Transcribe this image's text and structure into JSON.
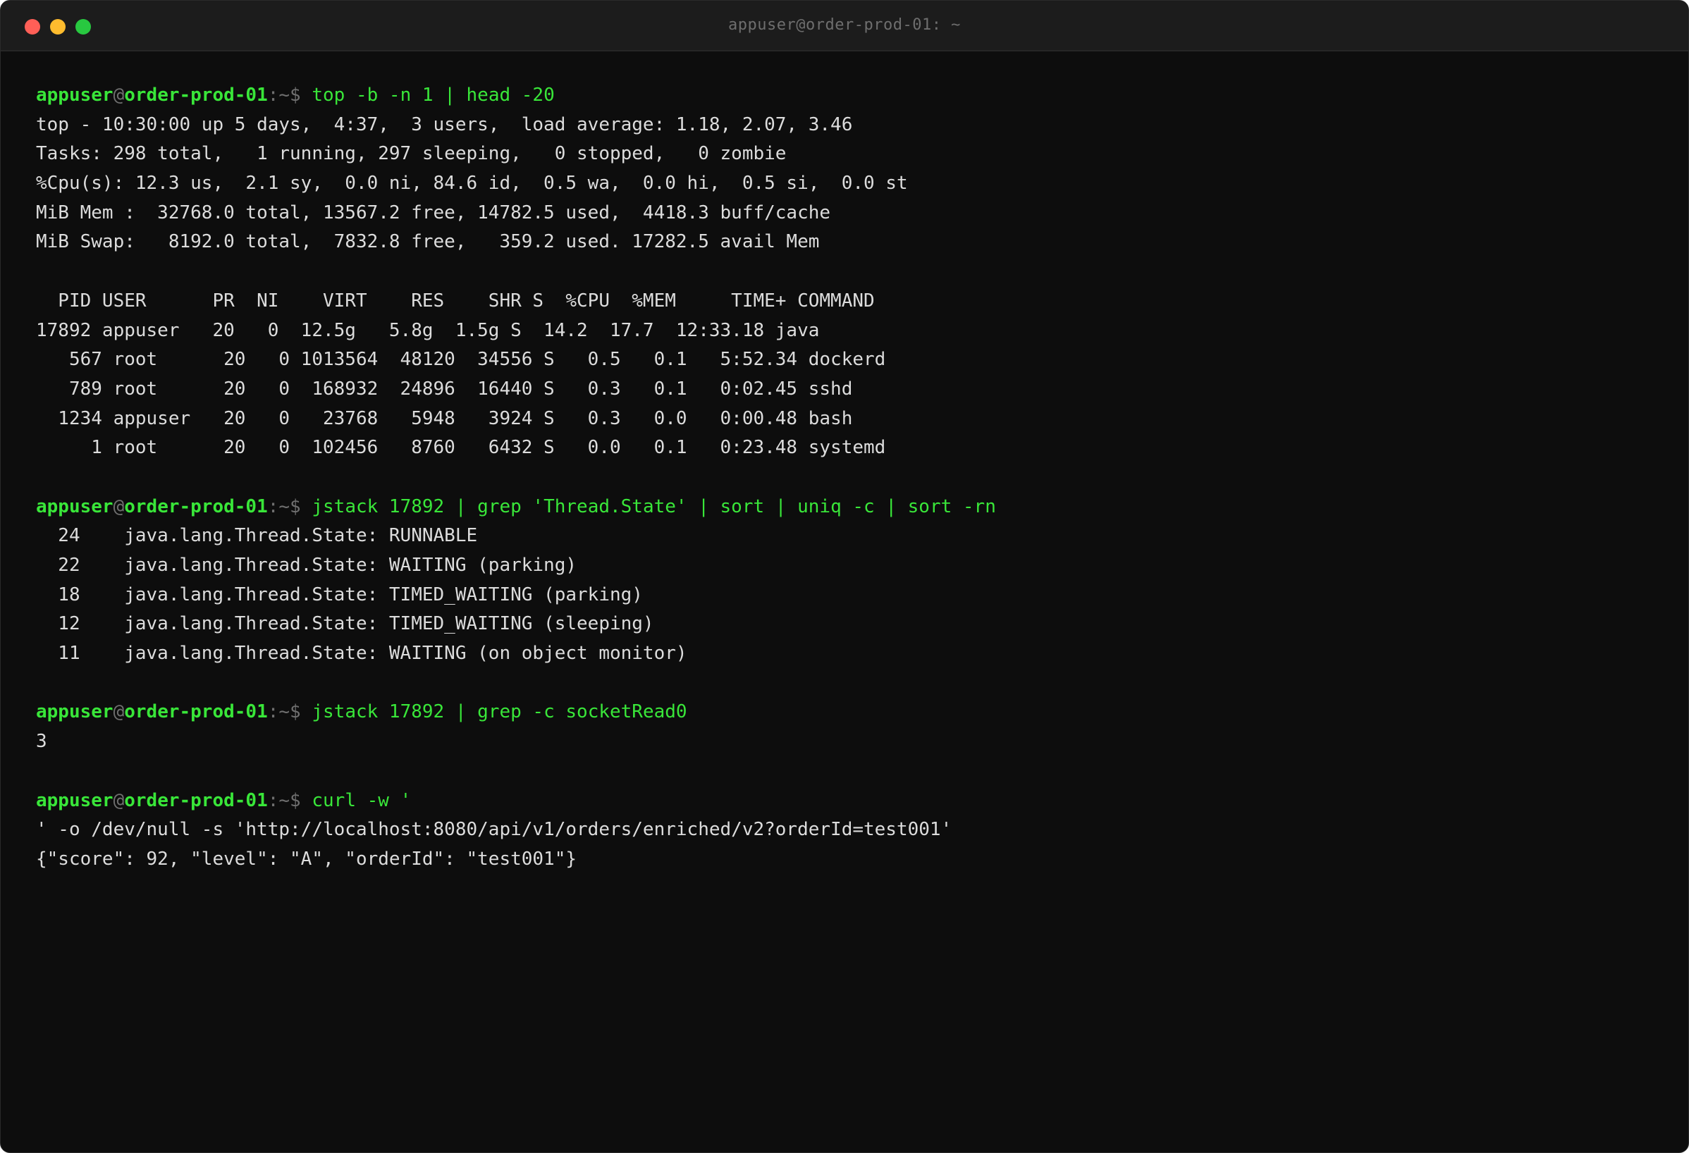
{
  "window": {
    "title": "appuser@order-prod-01: ~"
  },
  "prompt": {
    "user": "appuser",
    "at": "@",
    "host": "order-prod-01",
    "path": ":~",
    "symbol": "$ "
  },
  "blocks": [
    {
      "command": "top -b -n 1 | head -20",
      "output": [
        "top - 10:30:00 up 5 days,  4:37,  3 users,  load average: 1.18, 2.07, 3.46",
        "Tasks: 298 total,   1 running, 297 sleeping,   0 stopped,   0 zombie",
        "%Cpu(s): 12.3 us,  2.1 sy,  0.0 ni, 84.6 id,  0.5 wa,  0.0 hi,  0.5 si,  0.0 st",
        "MiB Mem :  32768.0 total, 13567.2 free, 14782.5 used,  4418.3 buff/cache",
        "MiB Swap:   8192.0 total,  7832.8 free,   359.2 used. 17282.5 avail Mem",
        "",
        "  PID USER      PR  NI    VIRT    RES    SHR S  %CPU  %MEM     TIME+ COMMAND",
        "17892 appuser   20   0  12.5g   5.8g  1.5g S  14.2  17.7  12:33.18 java",
        "   567 root      20   0 1013564  48120  34556 S   0.5   0.1   5:52.34 dockerd",
        "   789 root      20   0  168932  24896  16440 S   0.3   0.1   0:02.45 sshd",
        "  1234 appuser   20   0   23768   5948   3924 S   0.3   0.0   0:00.48 bash",
        "     1 root      20   0  102456   8760   6432 S   0.0   0.1   0:23.48 systemd",
        ""
      ]
    },
    {
      "command": "jstack 17892 | grep 'Thread.State' | sort | uniq -c | sort -rn",
      "output": [
        "  24    java.lang.Thread.State: RUNNABLE",
        "  22    java.lang.Thread.State: WAITING (parking)",
        "  18    java.lang.Thread.State: TIMED_WAITING (parking)",
        "  12    java.lang.Thread.State: TIMED_WAITING (sleeping)",
        "  11    java.lang.Thread.State: WAITING (on object monitor)",
        ""
      ]
    },
    {
      "command": "jstack 17892 | grep -c socketRead0",
      "output": [
        "3",
        ""
      ]
    },
    {
      "command": "curl -w '",
      "output": [
        "' -o /dev/null -s 'http://localhost:8080/api/v1/orders/enriched/v2?orderId=test001'",
        "{\"score\": 92, \"level\": \"A\", \"orderId\": \"test001\"}"
      ]
    }
  ],
  "colors": {
    "background": "#0d0d0d",
    "titlebar": "#1c1c1c",
    "prompt_green": "#39e639",
    "muted": "#6f6f6f",
    "text": "#dcdcdc"
  }
}
